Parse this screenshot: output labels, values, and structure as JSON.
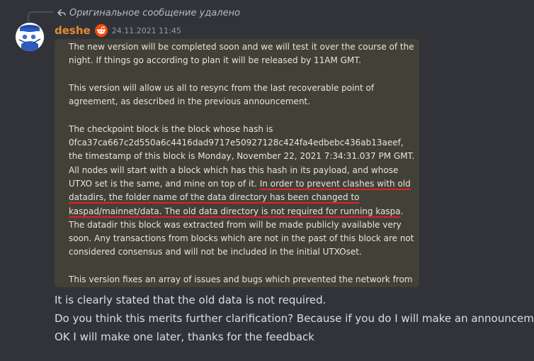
{
  "reply": {
    "icon": "reply-arrow-icon",
    "text": "Оригинальное сообщение удалено"
  },
  "message": {
    "author": "deshe",
    "badge_icon": "reddit-icon",
    "timestamp": "24.11.2021 11:45",
    "avatar_icon": "avatar-image"
  },
  "attachment": {
    "paragraph1": "The new version will be completed soon and we will test it over the course of the night. If things  go according to plan it will be released by 11AM GMT.",
    "paragraph2": "This version will allow us all to resync from the last recoverable point of agreement, as described in the previous announcement.",
    "paragraph3_part1": "The checkpoint block is the block whose hash is 0fca37ca667c2d550a6c4416dad9717e50927128c424fa4edbebc436ab13aeef, the timestamp of this block is Monday, November 22, 2021 7:34:31.037 PM GMT. All nodes will start with a block which has this hash in its payload, and whose UTXO set is the same, and mine on top of it. ",
    "paragraph3_underlined": "In order to prevent clashes with old datadirs, the folder name of the data directory has been changed to kaspad/mainnet/data. The old data directory is not required for running kaspa",
    "paragraph3_part2": ". The datadir this block was extracted from will be made publicly available very soon. Any transactions from blocks which are not in the past of this block are not considered consensus and will not be included in the initial UTXOset.",
    "paragraph4": "This version fixes an array of issues and bugs which prevented the network from properly syncing, we are hopeful that this version will prove to be considerably more"
  },
  "messages": [
    "It is clearly stated that the old data is not required.",
    "Do you think this merits further clarification? Because if you do I will make an announcement.",
    "OK I will make one later, thanks for the feedback"
  ],
  "colors": {
    "background": "#323339",
    "username": "#e58c2e",
    "card": "#434038",
    "underline": "#e02020"
  }
}
